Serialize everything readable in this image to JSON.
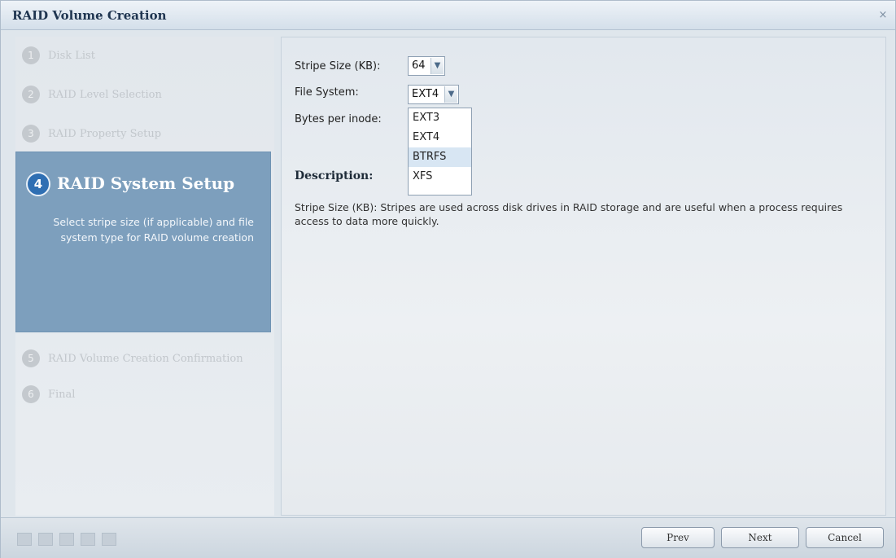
{
  "window": {
    "title": "RAID Volume Creation",
    "close_symbol": "×"
  },
  "steps": [
    {
      "num": "1",
      "label": "Disk List"
    },
    {
      "num": "2",
      "label": "RAID Level Selection"
    },
    {
      "num": "3",
      "label": "RAID Property Setup"
    },
    {
      "num": "4",
      "label": "RAID System Setup",
      "description": "Select stripe size (if applicable) and file system type for RAID volume creation"
    },
    {
      "num": "5",
      "label": "RAID Volume Creation Confirmation"
    },
    {
      "num": "6",
      "label": "Final"
    }
  ],
  "form": {
    "stripe_label": "Stripe Size (KB):",
    "stripe_value": "64",
    "fs_label": "File System:",
    "fs_value": "EXT4",
    "inode_label": "Bytes per inode:",
    "fs_options": [
      "EXT3",
      "EXT4",
      "BTRFS",
      "XFS"
    ],
    "fs_highlighted": "BTRFS"
  },
  "description": {
    "title": "Description:",
    "text": "Stripe Size (KB): Stripes are used across disk drives in RAID storage and are useful when a process requires access to data more quickly."
  },
  "footer": {
    "prev": "Prev",
    "next": "Next",
    "cancel": "Cancel"
  },
  "icons": {
    "dropdown": "chevron-down-icon",
    "close": "close-icon"
  }
}
